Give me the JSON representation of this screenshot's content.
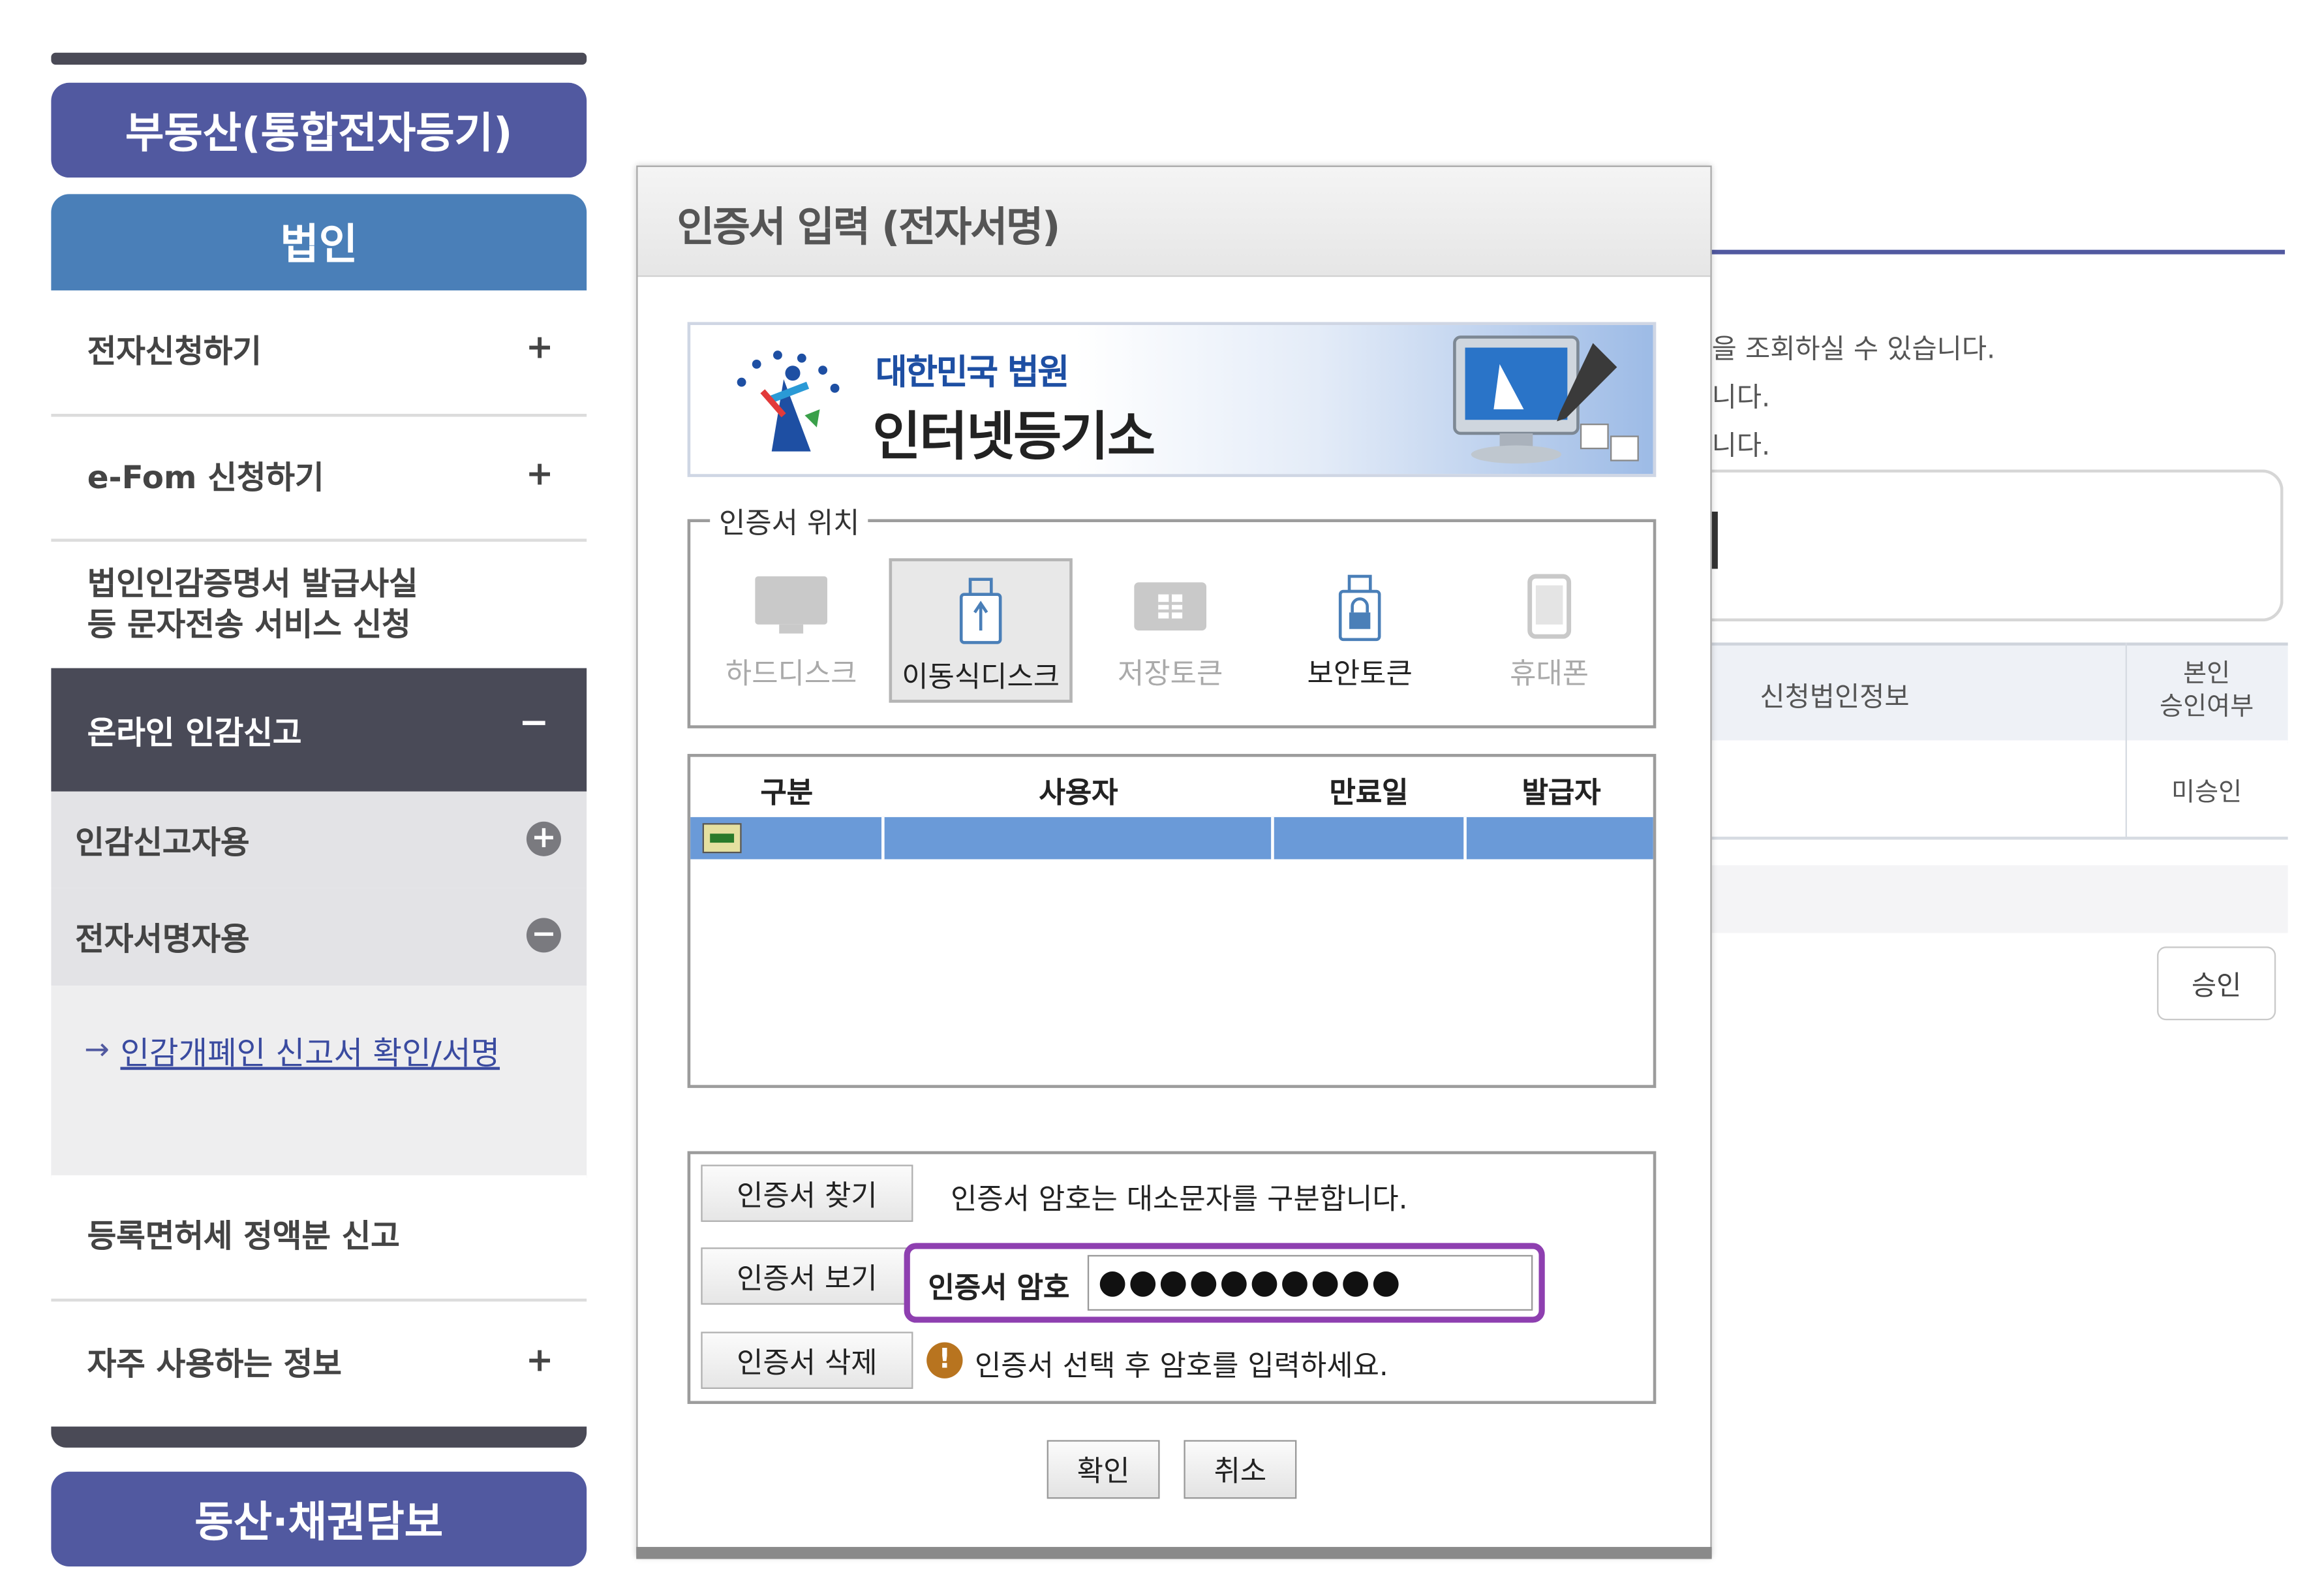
{
  "sidebar": {
    "top_button": "부동산(통합전자등기)",
    "section_title": "법인",
    "items": [
      {
        "label": "전자신청하기",
        "toggle": "+"
      },
      {
        "label": "e-Fom 신청하기",
        "toggle": "+"
      },
      {
        "label": "법인인감증명서 발급사실\n등 문자전송 서비스 신청",
        "toggle": ""
      }
    ],
    "active_group": {
      "label": "온라인 인감신고",
      "toggle": "−"
    },
    "sub_items": [
      {
        "label": "인감신고자용",
        "toggle": "+"
      },
      {
        "label": "전자서명자용",
        "toggle": "−"
      }
    ],
    "link_arrow": "→",
    "link": "인감개폐인 신고서 확인/서명",
    "items_after": [
      {
        "label": "등록면허세 정액분 신고",
        "toggle": ""
      },
      {
        "label": "자주 사용하는 정보",
        "toggle": "+"
      }
    ],
    "bottom_button": "동산·채권담보"
  },
  "background": {
    "lines": [
      "을 조회하실 수 있습니다.",
      "니다.",
      "니다."
    ],
    "table_headers": [
      "신청법인정보",
      "본인\n승인여부"
    ],
    "table_row": [
      "",
      "미승인"
    ],
    "approve_button": "승인"
  },
  "dialog": {
    "title": "인증서 입력 (전자서명)",
    "banner": {
      "court": "대한민국 법원",
      "registry": "인터넷등기소"
    },
    "location_legend": "인증서 위치",
    "locations": [
      {
        "label": "하드디스크",
        "icon": "monitor-icon",
        "state": "disabled"
      },
      {
        "label": "이동식디스크",
        "icon": "usb-drive-icon",
        "state": "selected"
      },
      {
        "label": "저장토큰",
        "icon": "chip-card-icon",
        "state": "disabled"
      },
      {
        "label": "보안토큰",
        "icon": "lock-token-icon",
        "state": "enabled"
      },
      {
        "label": "휴대폰",
        "icon": "phone-icon",
        "state": "disabled"
      }
    ],
    "grid_headers": [
      "구분",
      "사용자",
      "만료일",
      "발급자"
    ],
    "buttons": {
      "find": "인증서 찾기",
      "view": "인증서 보기",
      "delete": "인증서 삭제"
    },
    "case_note": "인증서 암호는 대소문자를 구분합니다.",
    "password_label": "인증서 암호",
    "password_value": "●●●●●●●●●●",
    "warning_note": "인증서 선택 후 암호를 입력하세요.",
    "ok": "확인",
    "cancel": "취소"
  },
  "colors": {
    "accent": "#5159a0",
    "section_blue": "#4a7fb8",
    "dark_menu": "#494a57",
    "highlight": "#8e3fb0",
    "row_select": "#6a9ad8"
  }
}
